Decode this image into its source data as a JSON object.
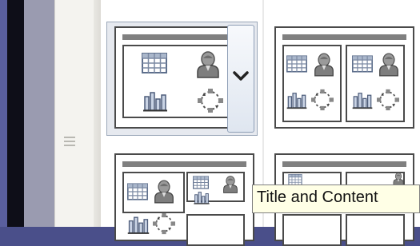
{
  "colors": {
    "gallery_bg": "#ffffff",
    "frame": "#4a4a4a",
    "title_bar": "#808080",
    "selection": "#9aa7b8",
    "tooltip_bg": "#ffffe6"
  },
  "icons": [
    "table-icon",
    "person-icon",
    "chart-icon",
    "smartart-cycle-icon",
    "chevron-down-icon",
    "grip-icon"
  ],
  "gallery": {
    "layouts": [
      {
        "state": "selected",
        "placeholders": 1
      },
      {
        "state": "normal",
        "placeholders": 2
      },
      {
        "state": "normal",
        "placeholders": 4
      },
      {
        "state": "normal",
        "placeholders": 4
      }
    ]
  },
  "tooltip": {
    "text": "Title and Content"
  }
}
